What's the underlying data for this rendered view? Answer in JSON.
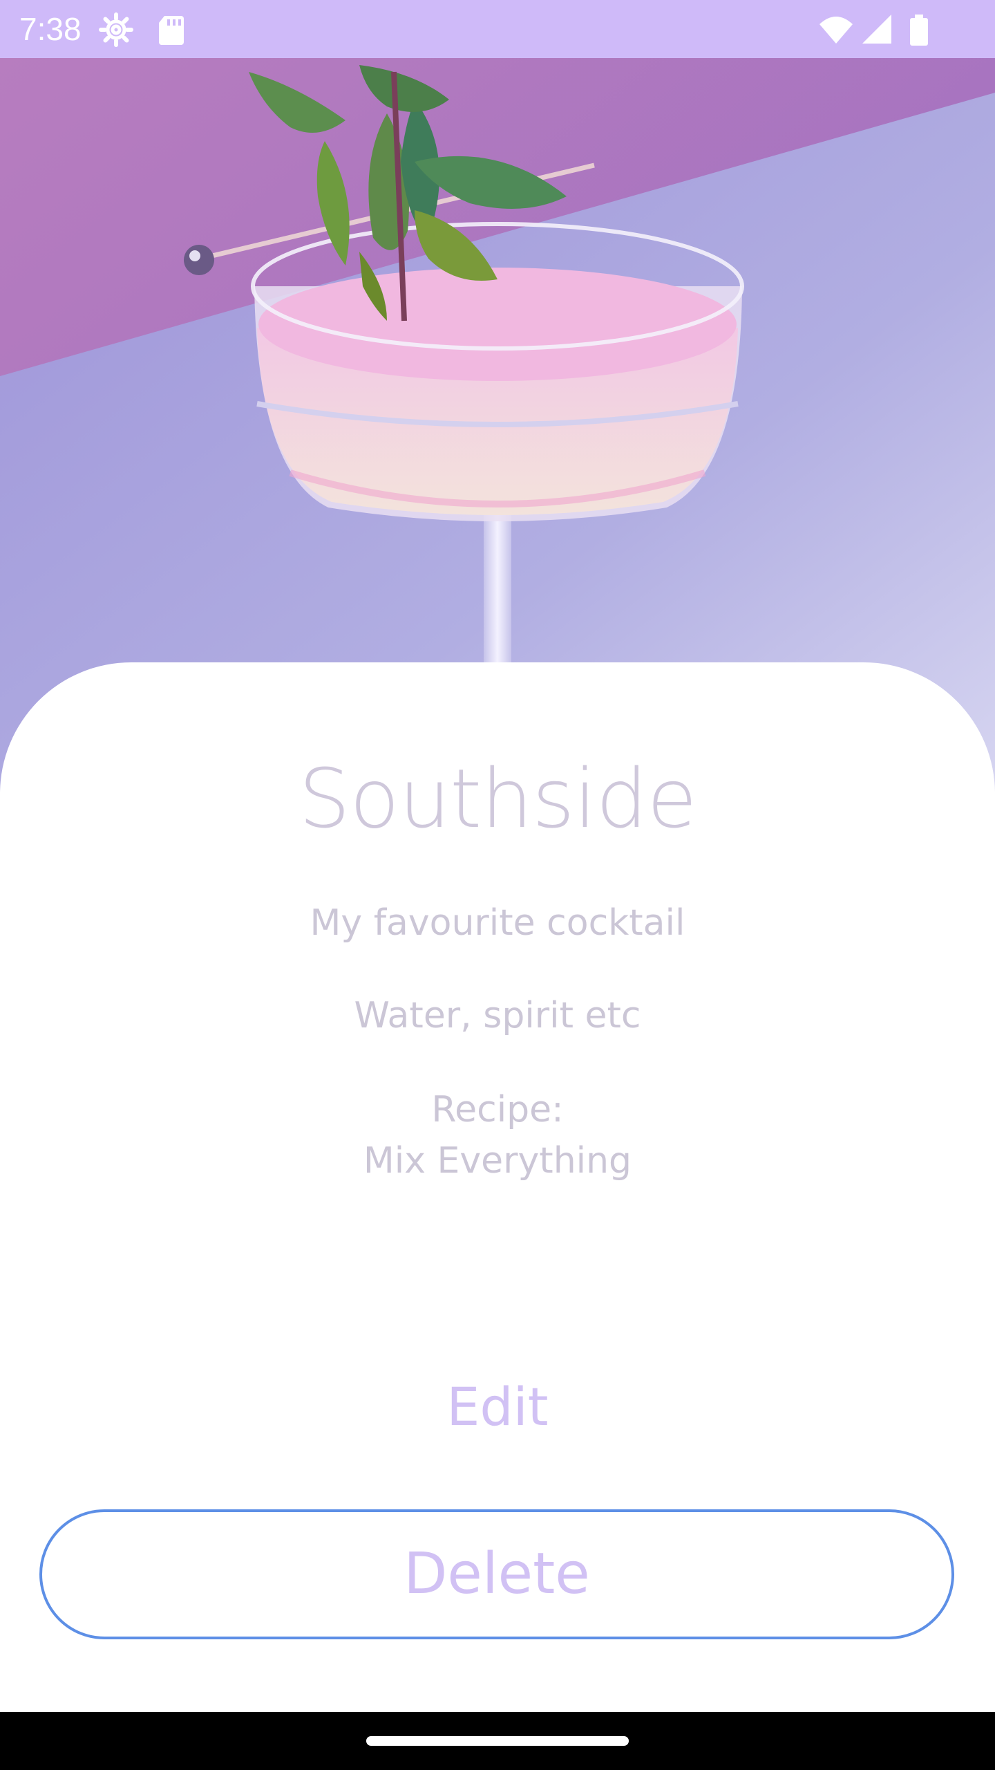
{
  "status_bar": {
    "time": "7:38",
    "left_icons": [
      "settings-gear-icon",
      "sd-card-icon"
    ],
    "right_icons": [
      "wifi-icon",
      "cell-signal-icon",
      "battery-icon"
    ],
    "background_color": "#cfbaf9"
  },
  "hero": {
    "image_description": "cocktail in coupe glass with mint garnish"
  },
  "cocktail": {
    "name": "Southside",
    "description": "My favourite cocktail",
    "ingredients": "Water, spirit etc",
    "recipe_label": "Recipe:",
    "recipe_text": "Mix Everything"
  },
  "actions": {
    "edit_label": "Edit",
    "delete_label": "Delete"
  },
  "colors": {
    "accent_text": "#d1c1f4",
    "delete_border": "#5d8fe6",
    "title_text": "#cfc8db"
  }
}
